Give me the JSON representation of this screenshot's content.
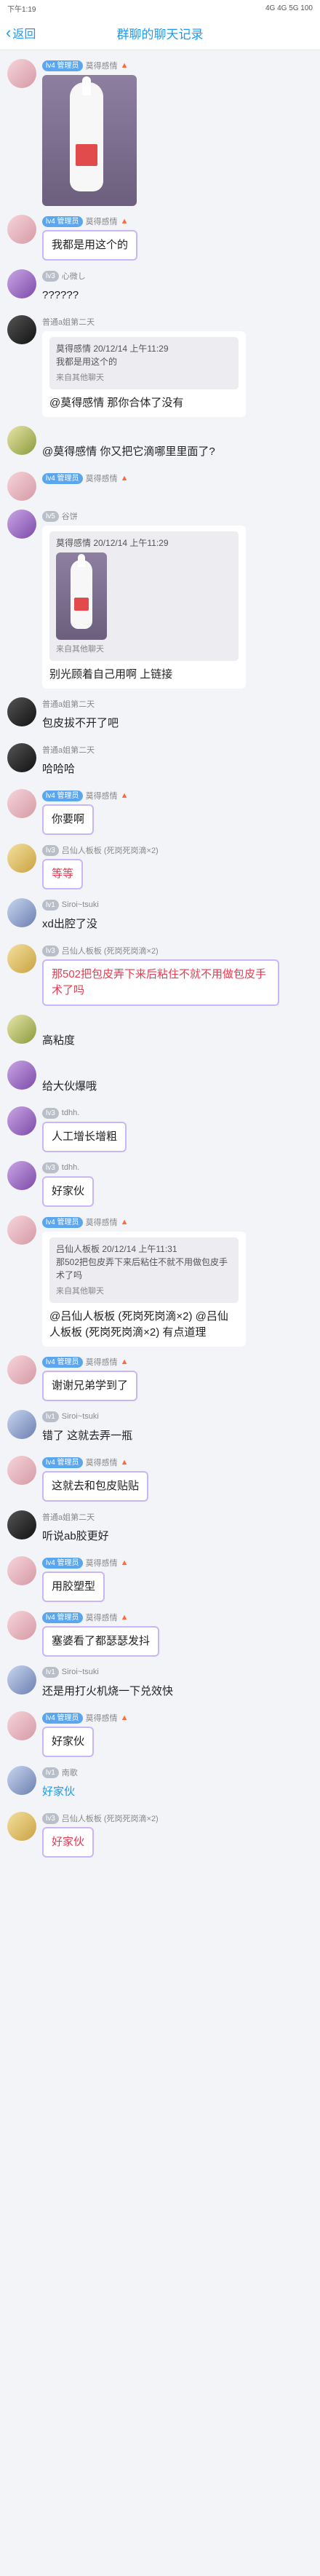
{
  "status": {
    "time": "下午1:19",
    "right": "4G 4G 5G 100"
  },
  "header": {
    "back": "返回",
    "title": "群聊的聊天记录"
  },
  "messages": [
    {
      "kind": "image",
      "tag": "lv4 管理员",
      "name": "莫得感情",
      "avatar": "pink"
    },
    {
      "kind": "text",
      "tag": "lv4 管理员",
      "name": "莫得感情",
      "avatar": "pink",
      "text": "我都是用这个的",
      "framed": true
    },
    {
      "kind": "text",
      "tag": "lv3",
      "name": "心微し",
      "avatar": "purple",
      "text": "??????",
      "plain": true
    },
    {
      "kind": "quote",
      "name": "普通a姐第二天",
      "avatar": "dark",
      "quote_head": "莫得感情 20/12/14 上午11:29",
      "quote_body": "我都是用这个的",
      "quote_src": "来自其他聊天",
      "text": "@莫得感情 那你合体了没有"
    },
    {
      "kind": "text",
      "name": "",
      "avatar": "green",
      "text": "@莫得感情 你又把它滴哪里里面了?",
      "plain": true
    },
    {
      "kind": "avatar-only",
      "tag": "lv4 管理员",
      "name": "莫得感情",
      "avatar": "pink"
    },
    {
      "kind": "imgquote",
      "tag": "lv5",
      "name": "谷饼",
      "avatar": "purple",
      "quote_head": "莫得感情 20/12/14 上午11:29",
      "quote_src": "来自其他聊天",
      "text": "别光顾着自己用啊 上链接"
    },
    {
      "kind": "text",
      "name": "普通a姐第二天",
      "avatar": "dark",
      "text": "包皮拔不开了吧",
      "plain": true
    },
    {
      "kind": "text",
      "name": "普通a姐第二天",
      "avatar": "dark",
      "text": "哈哈哈",
      "plain": true
    },
    {
      "kind": "text",
      "tag": "lv4 管理员",
      "name": "莫得感情",
      "avatar": "pink",
      "text": "你要啊",
      "framed": true
    },
    {
      "kind": "text",
      "tag": "lv3",
      "name": "吕仙人板板 (死岗死岗滴×2)",
      "avatar": "gold",
      "text": "等等",
      "framed": true,
      "red": true
    },
    {
      "kind": "text",
      "tag": "lv1",
      "name": "Siroi~tsuki",
      "avatar": "blue",
      "text": "xd出腔了没",
      "plain": true
    },
    {
      "kind": "text",
      "tag": "lv3",
      "name": "吕仙人板板 (死岗死岗滴×2)",
      "avatar": "gold",
      "text": "那502把包皮弄下来后粘住不就不用做包皮手术了吗",
      "framed": true,
      "red": true
    },
    {
      "kind": "text",
      "name": "",
      "avatar": "green",
      "text": "高粘度",
      "plain": true
    },
    {
      "kind": "text",
      "name": "",
      "avatar": "purple",
      "text": "给大伙爆哦",
      "plain": true
    },
    {
      "kind": "text",
      "tag": "lv3",
      "name": "tdhh.",
      "avatar": "purple",
      "text": "人工增长增粗",
      "framed": true
    },
    {
      "kind": "text",
      "tag": "lv3",
      "name": "tdhh.",
      "avatar": "purple",
      "text": "好家伙",
      "framed": true
    },
    {
      "kind": "quote",
      "tag": "lv4 管理员",
      "name": "莫得感情",
      "avatar": "pink",
      "quote_head": "吕仙人板板 20/12/14 上午11:31",
      "quote_body": "那502把包皮弄下来后粘住不就不用做包皮手术了吗",
      "quote_src": "来自其他聊天",
      "text": "@吕仙人板板 (死岗死岗滴×2) @吕仙人板板 (死岗死岗滴×2) 有点道理"
    },
    {
      "kind": "text",
      "tag": "lv4 管理员",
      "name": "莫得感情",
      "avatar": "pink",
      "text": "谢谢兄弟学到了",
      "framed": true
    },
    {
      "kind": "text",
      "tag": "lv1",
      "name": "Siroi~tsuki",
      "avatar": "blue",
      "text": "错了 这就去弄一瓶",
      "plain": true
    },
    {
      "kind": "text",
      "tag": "lv4 管理员",
      "name": "莫得感情",
      "avatar": "pink",
      "text": "这就去和包皮贴贴",
      "framed": true
    },
    {
      "kind": "text",
      "name": "普通a姐第二天",
      "avatar": "dark",
      "text": "听说ab胶更好",
      "plain": true
    },
    {
      "kind": "text",
      "tag": "lv4 管理员",
      "name": "莫得感情",
      "avatar": "pink",
      "text": "用胶塑型",
      "framed": true
    },
    {
      "kind": "text",
      "tag": "lv4 管理员",
      "name": "莫得感情",
      "avatar": "pink",
      "text": "塞婆看了都瑟瑟发抖",
      "framed": true
    },
    {
      "kind": "text",
      "tag": "lv1",
      "name": "Siroi~tsuki",
      "avatar": "blue",
      "text": "还是用打火机烧一下兑效快",
      "plain": true
    },
    {
      "kind": "text",
      "tag": "lv4 管理员",
      "name": "莫得感情",
      "avatar": "pink",
      "text": "好家伙",
      "framed": true
    },
    {
      "kind": "text",
      "tag": "lv1",
      "name": "南歌",
      "avatar": "blue",
      "text": "好家伙",
      "plain": true,
      "blue": true
    },
    {
      "kind": "text",
      "tag": "lv3",
      "name": "吕仙人板板 (死岗死岗滴×2)",
      "avatar": "gold",
      "text": "好家伙",
      "framed": true,
      "red": true
    }
  ]
}
